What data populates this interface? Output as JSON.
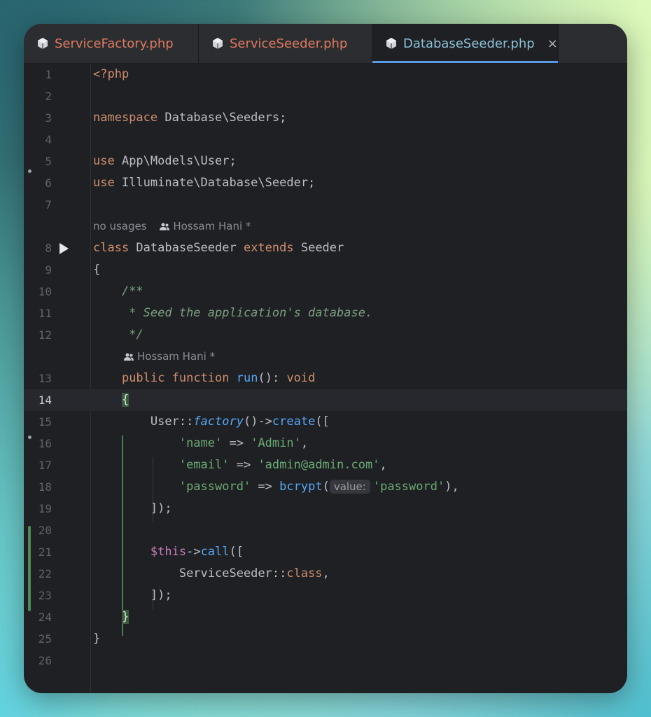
{
  "tabs": [
    {
      "label": "ServiceFactory.php",
      "active": false
    },
    {
      "label": "ServiceSeeder.php",
      "active": false
    },
    {
      "label": "DatabaseSeeder.php",
      "active": true
    }
  ],
  "close_glyph": "×",
  "current_line": 14,
  "meta": {
    "class_usages": "no usages",
    "class_author": "Hossam Hani *",
    "method_author": "Hossam Hani *"
  },
  "lines": {
    "1": "<?php",
    "3_kw": "namespace",
    "3_rest": " Database\\Seeders;",
    "5_kw": "use",
    "5_rest": " App\\Models\\User;",
    "6_kw": "use",
    "6_rest": " Illuminate\\Database\\Seeder;",
    "8_kw1": "class",
    "8_name": " DatabaseSeeder ",
    "8_kw2": "extends",
    "8_rest": " Seeder",
    "9": "{",
    "10": "/**",
    "11": " * Seed the application's database.",
    "12": " */",
    "13_kw1": "public",
    "13_kw2": "function",
    "13_fn": "run",
    "13_mid": "(): ",
    "13_kw3": "void",
    "14": "{",
    "15_a": "User::",
    "15_fn1": "factory",
    "15_b": "()->",
    "15_fn2": "create",
    "15_c": "([",
    "16_key": "'name'",
    "16_op": " => ",
    "16_val": "'Admin'",
    "16_end": ",",
    "17_key": "'email'",
    "17_op": " => ",
    "17_val": "'admin@admin.com'",
    "17_end": ",",
    "18_key": "'password'",
    "18_op": " => ",
    "18_fn": "bcrypt",
    "18_paren": "(",
    "18_hint": "value:",
    "18_val": "'password'",
    "18_end": "),",
    "19": "]);",
    "21_var": "$this",
    "21_arrow": "->",
    "21_fn": "call",
    "21_end": "([",
    "22_a": "ServiceSeeder::",
    "22_kw": "class",
    "22_end": ",",
    "23": "]);",
    "24": "}",
    "25": "}"
  },
  "line_numbers": [
    "1",
    "2",
    "3",
    "4",
    "5",
    "6",
    "7",
    "8",
    "9",
    "10",
    "11",
    "12",
    "13",
    "14",
    "15",
    "16",
    "17",
    "18",
    "19",
    "20",
    "21",
    "22",
    "23",
    "24",
    "25",
    "26"
  ],
  "icons": {
    "tab": "php-cube-icon",
    "run": "run-gutter-icon",
    "author": "people-icon"
  },
  "colors": {
    "keyword": "#cf8e6d",
    "string": "#6aab73",
    "function": "#56a8f5",
    "comment": "#7a9e7e",
    "variable": "#c77dbb"
  }
}
